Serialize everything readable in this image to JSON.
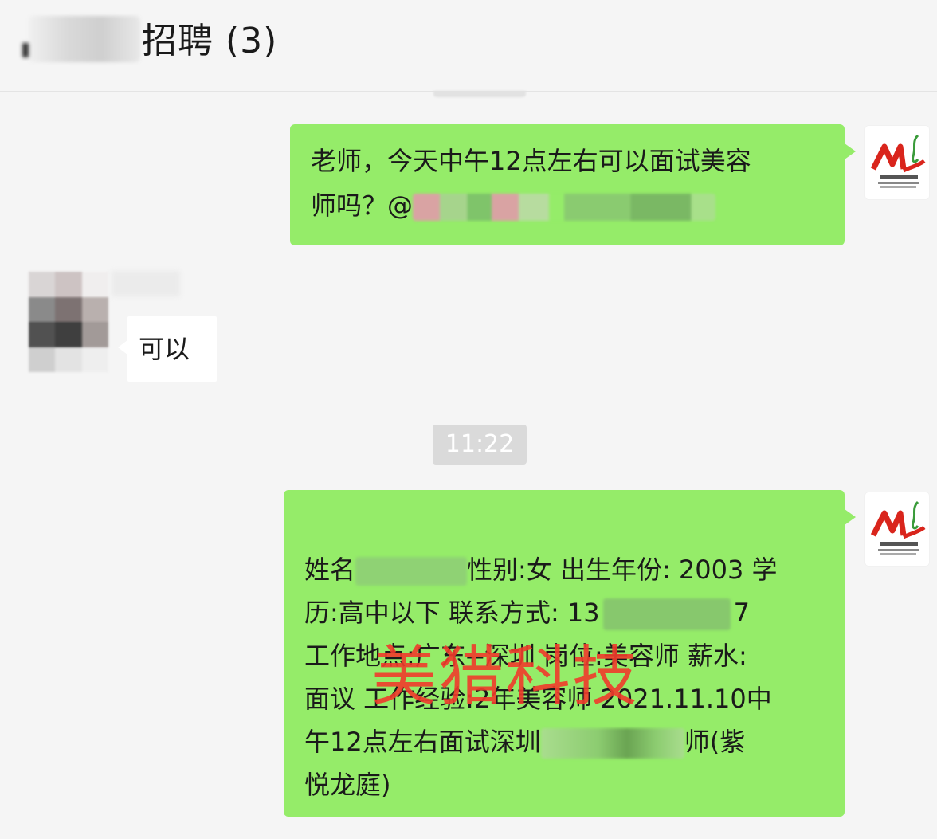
{
  "header": {
    "title": "招聘 (3)"
  },
  "messages": [
    {
      "side": "right",
      "line1": "老师，今天中午12点左右可以面试美容",
      "line2_prefix": "师吗？@"
    },
    {
      "side": "left",
      "text": "可以"
    },
    {
      "side": "right",
      "l1_a": "姓名",
      "l1_b": "性别:女 出生年份: 2003 学",
      "l2_a": "历:高中以下 联系方式: 13",
      "l2_b": "7",
      "l3": "工作地点:广东--深圳 岗位:美容师 薪水:",
      "l4": "面议 工作经验:2年美容师 2021.11.10中",
      "l5_a": "午12点左右面试深圳",
      "l5_b": "师(紫",
      "l6": "悦龙庭)"
    }
  ],
  "timestamp": "11:22",
  "watermark": "美猎科技",
  "colors": {
    "bubble_green": "#95ec69",
    "background": "#f5f5f5",
    "watermark_red": "#f03b2c"
  }
}
